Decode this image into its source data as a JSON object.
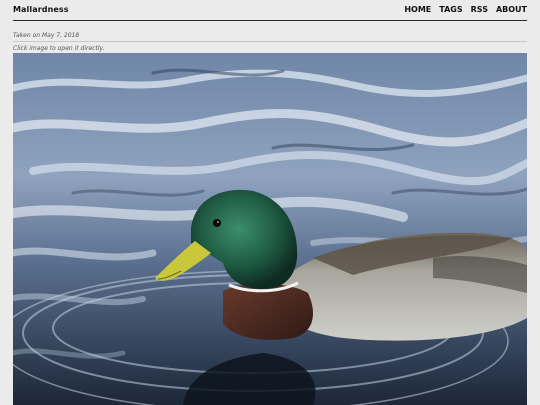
{
  "header": {
    "site_title": "Mallardness",
    "nav": [
      {
        "label": "HOME"
      },
      {
        "label": "TAGS"
      },
      {
        "label": "RSS"
      },
      {
        "label": "ABOUT"
      }
    ]
  },
  "post": {
    "taken_on": "Taken on May 7, 2018",
    "hint": "Click image to open it directly."
  },
  "colors": {
    "background": "#ebebeb",
    "text": "#111111",
    "water_dark": "#1d2a3c",
    "water_light": "#c9d6e6",
    "duck_head": "#1f5a43",
    "duck_bill": "#c9c83a",
    "duck_chest": "#4a2b22",
    "duck_body": "#a9a9a3"
  }
}
